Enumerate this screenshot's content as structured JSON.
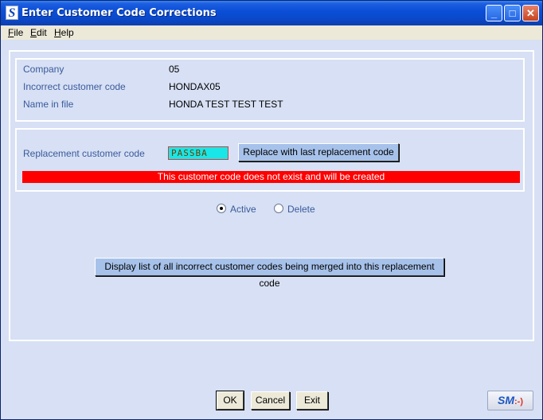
{
  "window": {
    "title": "Enter Customer Code Corrections",
    "app_icon": "S",
    "controls": {
      "minimize": "_",
      "maximize": "□",
      "close": "✕"
    }
  },
  "menu": [
    "File",
    "Edit",
    "Help"
  ],
  "info": {
    "company_label": "Company",
    "company_value": "05",
    "incorrect_label": "Incorrect customer code",
    "incorrect_value": "HONDAX05",
    "name_label": "Name in file",
    "name_value": "HONDA TEST TEST TEST"
  },
  "replacement": {
    "label": "Replacement customer code",
    "value": "PASSBA",
    "replace_button": "Replace with last replacement code",
    "error_message": "This customer code does not exist and will be created"
  },
  "status": {
    "active_label": "Active",
    "delete_label": "Delete",
    "selected": "Active"
  },
  "display_list_button": "Display list of all incorrect customer codes being merged into this replacement code",
  "footer": {
    "ok": "OK",
    "cancel": "Cancel",
    "exit": "Exit",
    "logo_text": "SM",
    "logo_face": ":-)"
  },
  "colors": {
    "window_bg": "#d7e0f4",
    "titlebar": "#0b4fd8",
    "label_text": "#3a5a9c",
    "error_bg": "#ff0000",
    "input_bg": "#19e6e6",
    "button_bg": "#a7c2ea"
  }
}
